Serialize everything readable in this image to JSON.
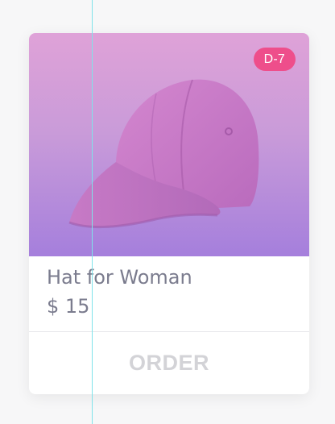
{
  "product": {
    "badge": "D-7",
    "image_icon": "cap-image",
    "title": "Hat for Woman",
    "price": "$ 15",
    "order_label": "ORDER"
  },
  "colors": {
    "badge_bg": "#ee4e8b",
    "gradient_top": "#dfa2d8",
    "gradient_bottom": "#a57fdc",
    "text": "#7b7c8e",
    "button_text": "#d3d3d7",
    "guide_line": "#7fe3ea"
  }
}
